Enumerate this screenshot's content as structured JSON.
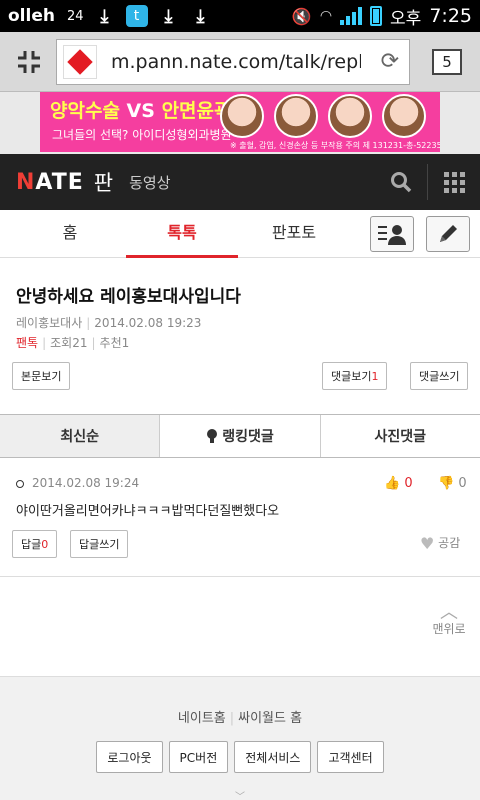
{
  "status_bar": {
    "carrier": "olleh",
    "notif_count": "24",
    "ampm": "오후",
    "time": "7:25",
    "app_letter": "t"
  },
  "browser": {
    "url": "m.pann.nate.com/talk/reply/v",
    "tab_count": "5"
  },
  "ad": {
    "headline_a": "양악수술",
    "headline_vs": "VS",
    "headline_b": "안면윤곽",
    "sub": "그녀들의 선택? 아이디성형외과병원",
    "brand": "id",
    "fine": "※ 출혈, 감염, 신경손상 등 부작용 주의   제 131231-총-52235호"
  },
  "site_header": {
    "logo_n": "N",
    "logo_rest": "ATE",
    "section": "판",
    "video_link": "동영상"
  },
  "nav": {
    "tabs": [
      {
        "label": "홈",
        "active": false
      },
      {
        "label": "톡톡",
        "active": true
      },
      {
        "label": "판포토",
        "active": false
      }
    ]
  },
  "post": {
    "title": "안녕하세요 레이홍보대사입니다",
    "author": "레이홍보대사",
    "date": "2014.02.08 19:23",
    "category": "팬톡",
    "views": "조회21",
    "recommends": "추천1",
    "btn_body": "본문보기",
    "btn_comments_label": "댓글보기",
    "btn_comments_count": "1",
    "btn_write_comment": "댓글쓰기"
  },
  "sort_tabs": [
    {
      "label": "최신순",
      "active": true
    },
    {
      "label": "랭킹댓글",
      "active": false
    },
    {
      "label": "사진댓글",
      "active": false
    }
  ],
  "comment": {
    "date": "2014.02.08 19:24",
    "like_count": "0",
    "dislike_count": "0",
    "body": "야이딴거올리면어카냐ㅋㅋㅋ밥먹다던질뻔했다오",
    "reply_label": "답글",
    "reply_count": "0",
    "write_reply": "답글쓰기",
    "empathy": "공감"
  },
  "to_top": "맨위로",
  "footer": {
    "link_nate": "네이트홈",
    "link_cyworld": "싸이월드 홈",
    "buttons": [
      "로그아웃",
      "PC버전",
      "전체서비스",
      "고객센터"
    ]
  },
  "colors": {
    "accent_red": "#e0242b",
    "header_bg": "#222222",
    "ad_pink": "#f53e9f"
  }
}
